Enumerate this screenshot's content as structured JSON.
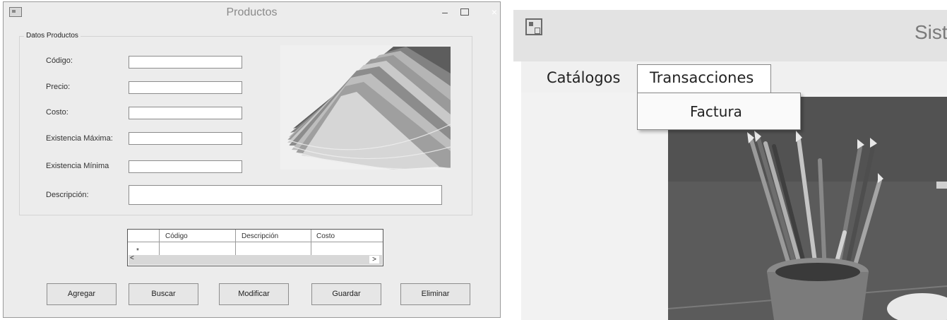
{
  "productos_window": {
    "title": "Productos",
    "controls": {
      "minimize": "–",
      "close": "×"
    },
    "group_title": "Datos Productos",
    "fields": [
      {
        "label": "Código:",
        "value": ""
      },
      {
        "label": "Precio:",
        "value": ""
      },
      {
        "label": "Costo:",
        "value": ""
      },
      {
        "label": "Existencia Máxima:",
        "value": ""
      },
      {
        "label": "Existencia Mínima",
        "value": ""
      },
      {
        "label": "Descripción:",
        "value": ""
      }
    ],
    "grid": {
      "columns": [
        "Código",
        "Descripción",
        "Costo"
      ],
      "new_row_marker": "*",
      "scroll_left": "<",
      "scroll_right": ">"
    },
    "buttons": [
      "Agregar",
      "Buscar",
      "Modificar",
      "Guardar",
      "Eliminar"
    ]
  },
  "main_window": {
    "title": "Sist",
    "menu": [
      "Catálogos",
      "Transacciones"
    ],
    "transacciones_submenu": [
      "Factura"
    ]
  },
  "icons": [
    "app-icon",
    "minimize-icon",
    "maximize-icon",
    "close-icon"
  ]
}
